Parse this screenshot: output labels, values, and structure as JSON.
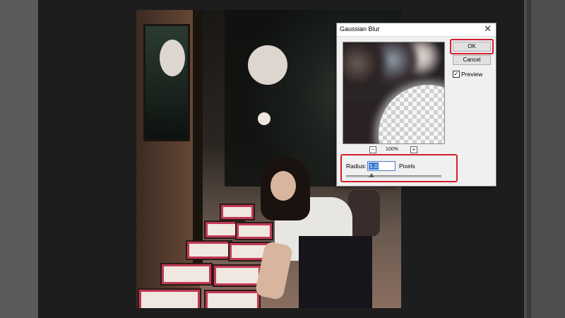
{
  "dialog": {
    "title": "Gaussian Blur",
    "close_icon": "close-icon",
    "ok_label": "OK",
    "cancel_label": "Cancel",
    "preview_label": "Preview",
    "preview_checked": true,
    "zoom_level": "100%",
    "zoom_out_glyph": "−",
    "zoom_in_glyph": "+",
    "radius_label": "Radius:",
    "radius_value": "5.0",
    "radius_unit": "Pixels",
    "highlight_color": "#d41f2c"
  }
}
